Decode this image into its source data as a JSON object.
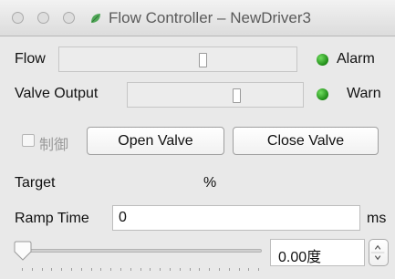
{
  "window": {
    "title": "Flow Controller – NewDriver3"
  },
  "flow": {
    "label": "Flow",
    "indicator_label": "Alarm",
    "level": 0.61
  },
  "valve_output": {
    "label": "Valve Output",
    "indicator_label": "Warn",
    "level": 0.63
  },
  "controls": {
    "checkbox_label": "制御",
    "open_button": "Open Valve",
    "close_button": "Close Valve"
  },
  "target": {
    "label": "Target",
    "unit": "%"
  },
  "ramp": {
    "label": "Ramp Time",
    "value": "0",
    "unit": "ms"
  },
  "slider": {
    "value_text": "0.00度",
    "position": 0.0
  },
  "colors": {
    "indicator_on": "#2aa01e"
  },
  "icons": {
    "app": "leaf-icon",
    "stepper": "stepper-icon"
  }
}
